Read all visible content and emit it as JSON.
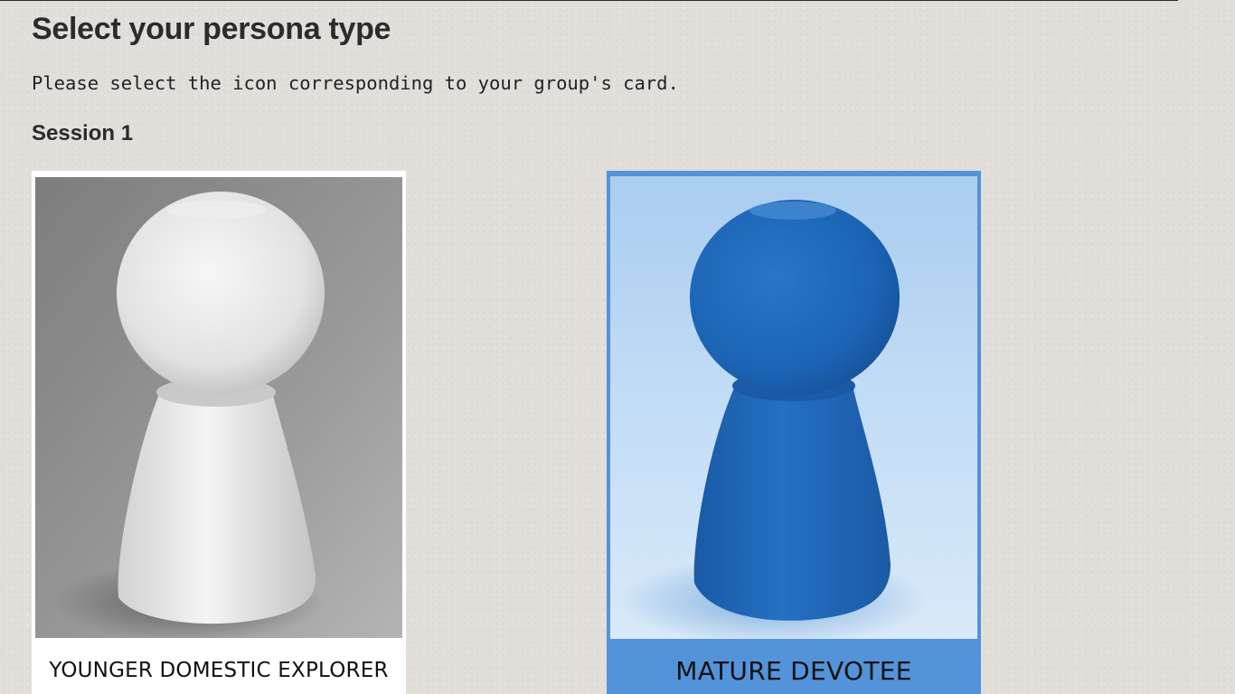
{
  "page": {
    "title": "Select your persona type",
    "instructions": "Please select the icon corresponding to your group's card."
  },
  "session": {
    "heading": "Session 1",
    "cards": [
      {
        "label": "YOUNGER DOMESTIC EXPLORER",
        "icon": "pawn-figurine-icon",
        "selected": false,
        "tint": "#ffffff"
      },
      {
        "label": "MATURE DEVOTEE",
        "icon": "pawn-figurine-icon",
        "selected": true,
        "tint": "#5393d9"
      }
    ]
  }
}
